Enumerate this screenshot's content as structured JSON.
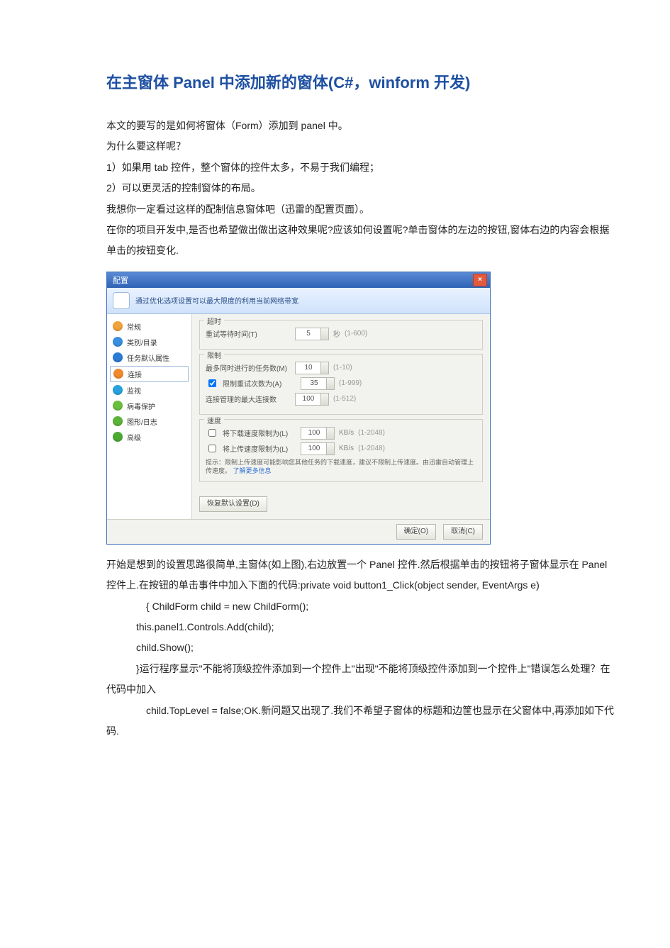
{
  "title": "在主窗体 Panel 中添加新的窗体(C#，winform 开发)",
  "intro": {
    "p1": "本文的要写的是如何将窗体（Form）添加到 panel 中。",
    "p2": "为什么要这样呢？",
    "p3": "1）如果用 tab 控件，整个窗体的控件太多，不易于我们编程；",
    "p4": "2）可以更灵活的控制窗体的布局。",
    "p5": "我想你一定看过这样的配制信息窗体吧（迅雷的配置页面）。",
    "p6": "在你的项目开发中,是否也希望做出做出这种效果呢?应该如何设置呢?单击窗体的左边的按钮,窗体右边的内容会根据单击的按钮变化."
  },
  "window": {
    "title": "配置",
    "banner": "通过优化选项设置可以最大限度的利用当前网络带宽",
    "sidebar": [
      {
        "label": "常规",
        "color": "c-orange"
      },
      {
        "label": "类别/目录",
        "color": "c-blue"
      },
      {
        "label": "任务默认属性",
        "color": "c-blue2"
      },
      {
        "label": "连接",
        "color": "c-orange2",
        "active": true
      },
      {
        "label": "监视",
        "color": "c-cyan"
      },
      {
        "label": "病毒保护",
        "color": "c-green"
      },
      {
        "label": "图形/日志",
        "color": "c-green2"
      },
      {
        "label": "高级",
        "color": "c-green3"
      }
    ],
    "groups": {
      "timeout": {
        "title": "超时",
        "row1": {
          "label": "重试等待时间(T)",
          "value": "5",
          "unit": "秒",
          "range": "(1-600)"
        }
      },
      "limit": {
        "title": "限制",
        "row1": {
          "label": "最多同时进行的任务数(M)",
          "value": "10",
          "range": "(1-10)"
        },
        "row2": {
          "checked": true,
          "label": "限制重试次数为(A)",
          "value": "35",
          "range": "(1-999)"
        },
        "row3": {
          "label": "连接管理的最大连接数",
          "value": "100",
          "range": "(1-512)"
        }
      },
      "speed": {
        "title": "速度",
        "row1": {
          "checked": false,
          "label": "将下载速度限制为(L)",
          "value": "100",
          "unit": "KB/s",
          "range": "(1-2048)"
        },
        "row2": {
          "checked": false,
          "label": "将上传速度限制为(L)",
          "value": "100",
          "unit": "KB/s",
          "range": "(1-2048)"
        },
        "hint_prefix": "提示：限制上传速度可能影响您其他任务的下载速度，建议不限制上传速度。由迅雷自动管理上传速度。",
        "hint_link": "了解更多信息"
      }
    },
    "restore_btn": "恢复默认设置(D)",
    "ok_btn": "确定(O)",
    "cancel_btn": "取消(C)"
  },
  "after": {
    "p1": "开始是想到的设置思路很简单,主窗体(如上图),右边放置一个 Panel 控件.然后根据单击的按钮将子窗体显示在 Panel 控件上.在按钮的单击事件中加入下面的代码:private void button1_Click(object sender, EventArgs e)",
    "p2": "{            ChildForm child = new ChildForm();",
    "p3": "this.panel1.Controls.Add(child);",
    "p4": "child.Show();",
    "p5": "}运行程序显示\"不能将顶级控件添加到一个控件上\"出现\"不能将顶级控件添加到一个控件上\"错误怎么处理？在代码中加入",
    "p6": "child.TopLevel = false;OK.新问题又出现了.我们不希望子窗体的标题和边筐也显示在父窗体中,再添加如下代码."
  }
}
